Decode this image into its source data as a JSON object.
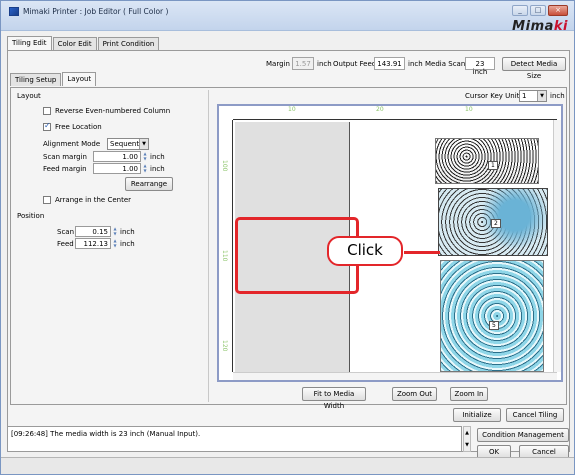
{
  "window": {
    "title": "Mimaki Printer : Job Editor ( Full Color )",
    "brand_prefix": "Mima",
    "brand_suffix": "ki",
    "controls": [
      "_",
      "□",
      "×"
    ]
  },
  "main_tabs": [
    "Tiling Edit",
    "Color Edit",
    "Print Condition"
  ],
  "topbar": {
    "margin_label": "Margin",
    "margin_value": "1.57",
    "margin_unit": "inch",
    "output_feed_label": "Output Feed",
    "output_feed_value": "143.91",
    "output_feed_unit": "inch",
    "media_scan_label": "Media Scan",
    "media_scan_value": "23 inch",
    "detect_button": "Detect Media Size"
  },
  "sub_tabs": [
    "Tiling Setup",
    "Layout"
  ],
  "layout": {
    "group_title": "Layout",
    "reverse_label": "Reverse Even-numbered Column",
    "free_location_label": "Free Location",
    "alignment_mode_label": "Alignment Mode",
    "alignment_mode_value": "Sequential",
    "scan_margin_label": "Scan margin",
    "scan_margin_value": "1.00",
    "feed_margin_label": "Feed margin",
    "feed_margin_value": "1.00",
    "unit": "inch",
    "rearrange_button": "Rearrange",
    "arrange_center_label": "Arrange in the Center"
  },
  "position": {
    "group_title": "Position",
    "scan_label": "Scan",
    "scan_value": "0.15",
    "feed_label": "Feed",
    "feed_value": "112.13",
    "unit": "inch"
  },
  "canvas": {
    "cursor_key_unit_label": "Cursor Key Unit",
    "cursor_key_unit_value": "1",
    "cursor_key_unit_unit": "inch",
    "ruler_top": [
      "10",
      "20",
      "10"
    ],
    "ruler_left": [
      "100",
      "110",
      "120"
    ],
    "tile_labels": [
      "1",
      "2",
      "5"
    ],
    "callout_text": "Click"
  },
  "buttons": {
    "fit_to_media_width": "Fit to Media Width",
    "zoom_out": "Zoom Out",
    "zoom_in": "Zoom In",
    "initialize": "Initialize",
    "cancel_tiling": "Cancel Tiling",
    "condition_management": "Condition Management",
    "ok": "OK",
    "cancel": "Cancel"
  },
  "log": {
    "message": "[09:26:48] The media width is 23 inch (Manual Input)."
  },
  "colors": {
    "highlight": "#e3262a",
    "ruler_green": "#8cc46a",
    "brand_red": "#c8102e"
  }
}
